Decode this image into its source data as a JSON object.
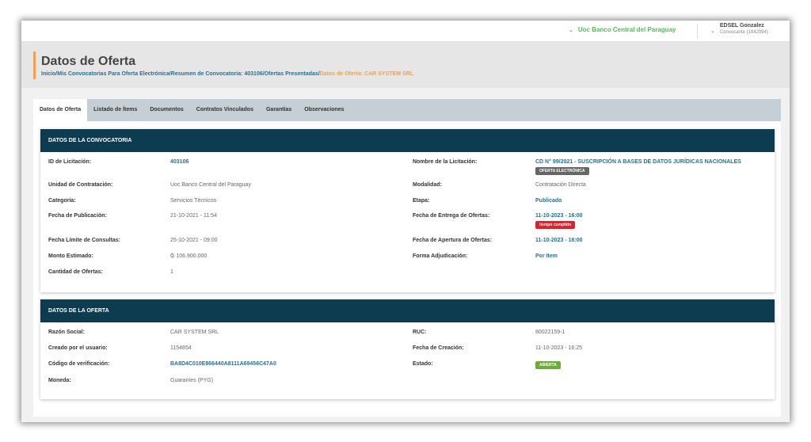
{
  "topbar": {
    "org": "Uoc Banco Central del Paraguay",
    "user_name": "EDSEL Gonzalez",
    "user_role": "Convocante (1842994)"
  },
  "header": {
    "title": "Datos de Oferta",
    "breadcrumb": [
      {
        "label": "Inicio",
        "sep": "/"
      },
      {
        "label": "Mis Convocatorias Para Oferta Electrónica",
        "sep": "/"
      },
      {
        "label": "Resumen de Convocatoria: 403106",
        "sep": "/"
      },
      {
        "label": "Ofertas Presentadas",
        "sep": "/"
      }
    ],
    "breadcrumb_current": "Datos de Oferta: CAR SYSTEM SRL"
  },
  "tabs": [
    {
      "label": "Datos de Oferta"
    },
    {
      "label": "Listado de Ítems"
    },
    {
      "label": "Documentos"
    },
    {
      "label": "Contratos Vinculados"
    },
    {
      "label": "Garantías"
    },
    {
      "label": "Observaciones"
    }
  ],
  "convocatoria": {
    "header": "DATOS DE LA CONVOCATORIA",
    "id_label": "ID de Licitación:",
    "id_value": "403106",
    "nombre_label": "Nombre de la Licitación:",
    "nombre_value": "CD N° 99/2021 - SUSCRIPCIÓN A BASES DE DATOS JURÍDICAS NACIONALES",
    "nombre_badge": "OFERTA ELECTRÓNICA",
    "unidad_label": "Unidad de Contratación:",
    "unidad_value": "Uoc Banco Central del Paraguay",
    "modalidad_label": "Modalidad:",
    "modalidad_value": "Contratación Directa",
    "categoria_label": "Categoría:",
    "categoria_value": "Servicios Técnicos",
    "etapa_label": "Etapa:",
    "etapa_value": "Publicado",
    "publicacion_label": "Fecha de Publicación:",
    "publicacion_value": "21-10-2021 - 11:54",
    "entrega_label": "Fecha de Entrega de Ofertas:",
    "entrega_value": "11-10-2023 - 16:00",
    "entrega_badge": "tiempo cumplido",
    "consultas_label": "Fecha Límite de Consultas:",
    "consultas_value": "25-10-2021 - 09:00",
    "apertura_label": "Fecha de Apertura de Ofertas:",
    "apertura_value": "11-10-2023 - 16:00",
    "monto_label": "Monto Estimado:",
    "monto_value": "₲ 106.900.000",
    "adjudicacion_label": "Forma Adjudicación:",
    "adjudicacion_value": "Por Item",
    "cantidad_label": "Cantidad de Ofertas:",
    "cantidad_value": "1"
  },
  "oferta": {
    "header": "DATOS DE LA OFERTA",
    "razon_label": "Razón Social:",
    "razon_value": "CAR SYSTEM SRL",
    "ruc_label": "RUC:",
    "ruc_value": "80022159-1",
    "creado_label": "Creado por el usuario:",
    "creado_value": "1154854",
    "fecha_label": "Fecha de Creación:",
    "fecha_value": "11-10-2023 - 16:25",
    "codigo_label": "Código de verificación:",
    "codigo_value": "BA8D4C010E866440A8111A69456C47A0",
    "estado_label": "Estado:",
    "estado_value": "ABIERTA",
    "moneda_label": "Moneda:",
    "moneda_value": "Guaraníes (PYG)"
  }
}
